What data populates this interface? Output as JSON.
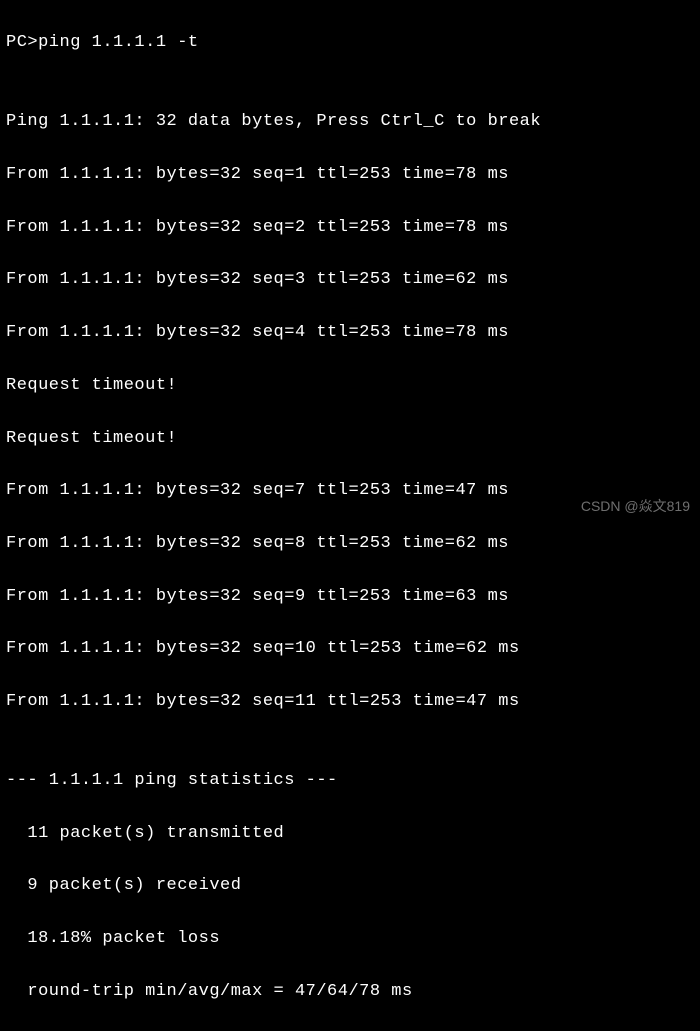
{
  "prompt": "PC>",
  "command": "ping 1.1.1.1 -t",
  "header": "Ping 1.1.1.1: 32 data bytes, Press Ctrl_C to break",
  "replies": [
    "From 1.1.1.1: bytes=32 seq=1 ttl=253 time=78 ms",
    "From 1.1.1.1: bytes=32 seq=2 ttl=253 time=78 ms",
    "From 1.1.1.1: bytes=32 seq=3 ttl=253 time=62 ms",
    "From 1.1.1.1: bytes=32 seq=4 ttl=253 time=78 ms"
  ],
  "timeouts": [
    "Request timeout!",
    "Request timeout!"
  ],
  "replies2": [
    "From 1.1.1.1: bytes=32 seq=7 ttl=253 time=47 ms",
    "From 1.1.1.1: bytes=32 seq=8 ttl=253 time=62 ms",
    "From 1.1.1.1: bytes=32 seq=9 ttl=253 time=63 ms",
    "From 1.1.1.1: bytes=32 seq=10 ttl=253 time=62 ms",
    "From 1.1.1.1: bytes=32 seq=11 ttl=253 time=47 ms"
  ],
  "stats": {
    "divider": "--- 1.1.1.1 ping statistics ---",
    "transmitted": "  11 packet(s) transmitted",
    "received": "  9 packet(s) received",
    "loss": "  18.18% packet loss",
    "roundtrip": "  round-trip min/avg/max = 47/64/78 ms"
  },
  "watermark": "CSDN @焱文819"
}
